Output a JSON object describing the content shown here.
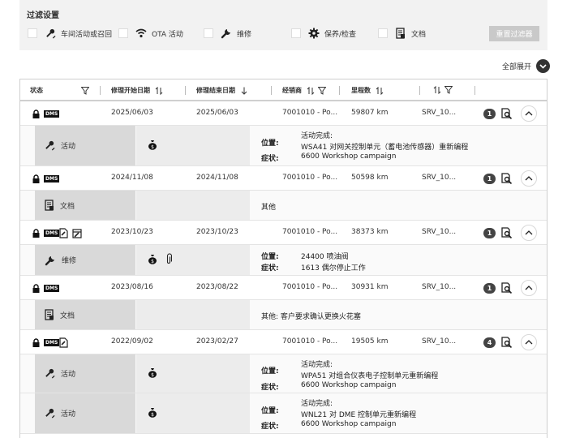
{
  "filter": {
    "title": "过滤设置",
    "options": [
      {
        "label": "车间活动或召回",
        "icon": "recall-wrench-icon"
      },
      {
        "label": "OTA 活动",
        "icon": "wifi-icon"
      },
      {
        "label": "维修",
        "icon": "wrench-icon"
      },
      {
        "label": "保养/检查",
        "icon": "gear-icon"
      },
      {
        "label": "文档",
        "icon": "document-icon"
      }
    ],
    "reset_label": "重置过滤器"
  },
  "expand_all_label": "全部展开",
  "table": {
    "headers": {
      "status": "状态",
      "start_date": "修理开始日期",
      "end_date": "修理结束日期",
      "dealer": "经销商",
      "mileage": "里程数",
      "last": ""
    },
    "records": [
      {
        "start": "2025/06/03",
        "end": "2025/06/03",
        "dealer": "7001010 - Po...",
        "mileage": "59807 km",
        "srv": "SRV_10...",
        "count": "1",
        "details": [
          {
            "type": "活动",
            "position_label": "位置:",
            "position_line1": "活动完成:",
            "position_line2": "WSA41 对网关控制单元（蓄电池传感器）重新编程",
            "symptom_label": "症状:",
            "symptom": "6600 Workshop campaign"
          }
        ]
      },
      {
        "start": "2024/11/08",
        "end": "2024/11/08",
        "dealer": "7001010 - Po...",
        "mileage": "50598 km",
        "srv": "SRV_10...",
        "count": "1",
        "details": [
          {
            "type": "文档",
            "other": "其他"
          }
        ]
      },
      {
        "start": "2023/10/23",
        "end": "2023/10/23",
        "dealer": "7001010 - Po...",
        "mileage": "38373 km",
        "srv": "SRV_10...",
        "count": "1",
        "details": [
          {
            "type": "维修",
            "position_label": "位置:",
            "position": "24400 喷油阀",
            "symptom_label": "症状:",
            "symptom": "1613 偶尔停止工作"
          }
        ]
      },
      {
        "start": "2023/08/16",
        "end": "2023/08/22",
        "dealer": "7001010 - Po...",
        "mileage": "30931 km",
        "srv": "SRV_10...",
        "count": "1",
        "details": [
          {
            "type": "文档",
            "other": "其他: 客户要求确认更换火花塞"
          }
        ]
      },
      {
        "start": "2022/09/02",
        "end": "2023/02/27",
        "dealer": "7001010 - Po...",
        "mileage": "19505 km",
        "srv": "SRV_10...",
        "count": "4",
        "details": [
          {
            "type": "活动",
            "position_label": "位置:",
            "position_line1": "活动完成:",
            "position_line2": "WPA51 对组合仪表电子控制单元重新编程",
            "symptom_label": "症状:",
            "symptom": "6600 Workshop campaign"
          },
          {
            "type": "活动",
            "position_label": "位置:",
            "position_line1": "活动完成:",
            "position_line2": "WNL21 对 DME 控制单元重新编程",
            "symptom_label": "症状:",
            "symptom": "6600 Workshop campaign"
          }
        ]
      }
    ]
  },
  "dms_label": "DMS"
}
